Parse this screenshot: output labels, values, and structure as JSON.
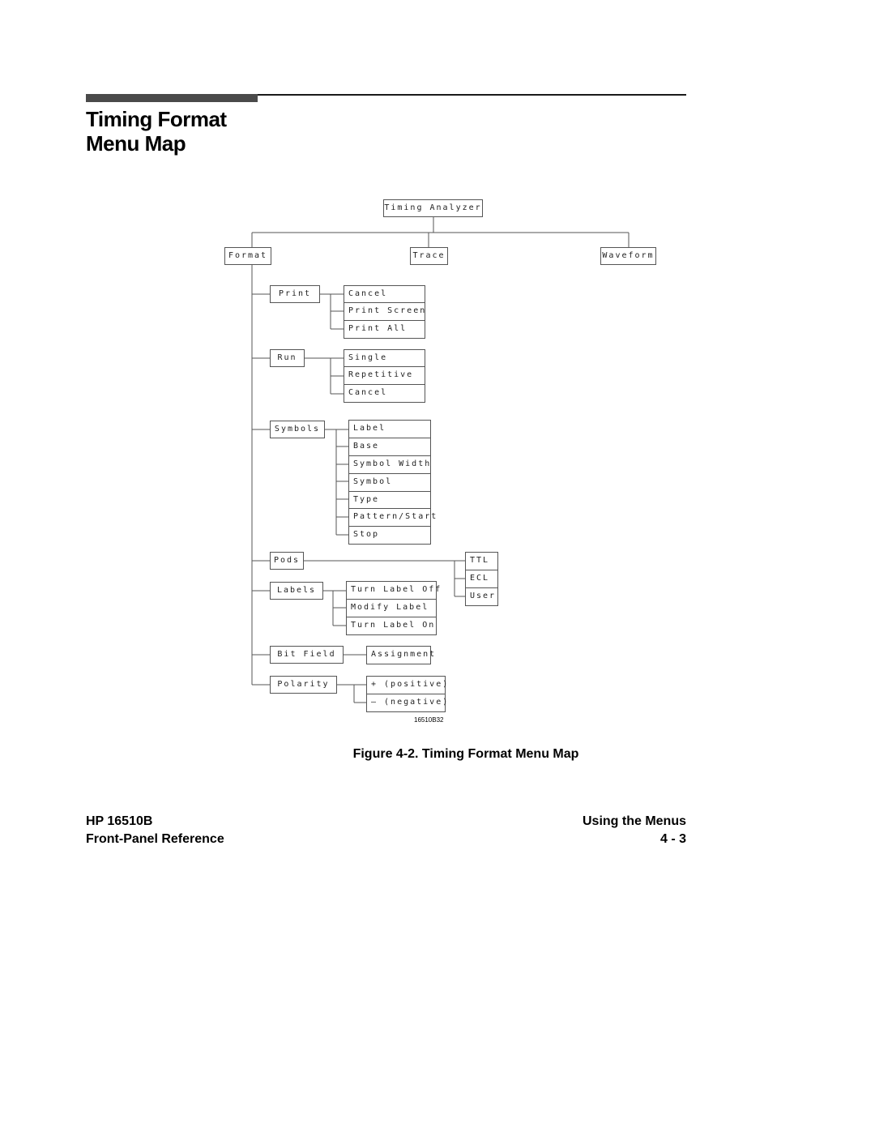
{
  "page": {
    "title_line1": "Timing Format",
    "title_line2": "Menu Map",
    "caption": "Figure 4-2. Timing Format Menu Map",
    "figure_id": "16510B32",
    "footer": {
      "left_line1": "HP 16510B",
      "left_line2": "Front-Panel Reference",
      "right_line1": "Using the Menus",
      "right_line2": "4 - 3"
    }
  },
  "menu_map": {
    "root": "Timing Analyzer",
    "top_level": [
      "Format",
      "Trace",
      "Waveform"
    ],
    "format_items": [
      {
        "label": "Print",
        "children": [
          "Cancel",
          "Print Screen",
          "Print All"
        ]
      },
      {
        "label": "Run",
        "children": [
          "Single",
          "Repetitive",
          "Cancel"
        ]
      },
      {
        "label": "Symbols",
        "children": [
          "Label",
          "Base",
          "Symbol Width",
          "Symbol",
          "Type",
          "Pattern/Start",
          "Stop"
        ]
      },
      {
        "label": "Pods",
        "children": [
          "TTL",
          "ECL",
          "User"
        ]
      },
      {
        "label": "Labels",
        "children": [
          "Turn Label Off",
          "Modify Label",
          "Turn Label On"
        ]
      },
      {
        "label": "Bit Field",
        "children": [
          "Assignment"
        ]
      },
      {
        "label": "Polarity",
        "children": [
          "+ (positive)",
          "— (negative)"
        ]
      }
    ]
  }
}
